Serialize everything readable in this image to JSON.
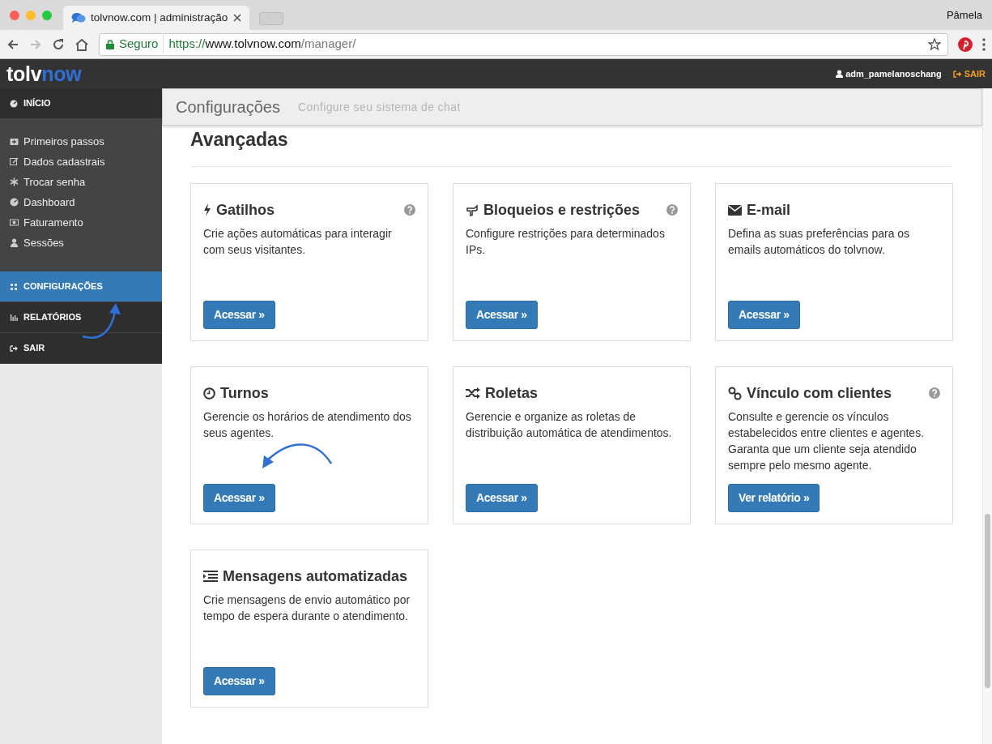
{
  "browser": {
    "tab_title": "tolvnow.com | administração",
    "profile": "Pâmela",
    "security_label": "Seguro",
    "url": {
      "scheme": "https://",
      "host": "www.tolvnow.com",
      "path": "/manager/"
    }
  },
  "header": {
    "logo": {
      "text": "tolv",
      "accent": "now"
    },
    "user": "adm_pamelanoschang",
    "logout": "SAIR"
  },
  "sidebar": {
    "items": [
      {
        "label": "INÍCIO",
        "kind": "main",
        "selected": false
      },
      {
        "label": "Primeiros passos",
        "kind": "sub",
        "selected": false
      },
      {
        "label": "Dados cadastrais",
        "kind": "sub",
        "selected": false
      },
      {
        "label": "Trocar senha",
        "kind": "sub",
        "selected": false
      },
      {
        "label": "Dashboard",
        "kind": "sub",
        "selected": false
      },
      {
        "label": "Faturamento",
        "kind": "sub",
        "selected": false
      },
      {
        "label": "Sessões",
        "kind": "sub",
        "selected": false
      },
      {
        "label": "CONFIGURAÇÕES",
        "kind": "main",
        "selected": true
      },
      {
        "label": "RELATÓRIOS",
        "kind": "main",
        "selected": false
      },
      {
        "label": "SAIR",
        "kind": "main",
        "selected": false
      }
    ]
  },
  "page_header": {
    "title": "Configurações",
    "subtitle": "Configure seu sistema de chat"
  },
  "section": {
    "title": "Avançadas",
    "cards": [
      {
        "title": "Gatilhos",
        "description": "Crie ações automáticas para interagir com seus visitantes.",
        "button": "Acessar »",
        "help": true
      },
      {
        "title": "Bloqueios e restrições",
        "description": "Configure restrições para determinados IPs.",
        "button": "Acessar »",
        "help": true
      },
      {
        "title": "E-mail",
        "description": "Defina as suas preferências para os emails automáticos do tolvnow.",
        "button": "Acessar »",
        "help": false
      },
      {
        "title": "Turnos",
        "description": "Gerencie os horários de atendimento dos seus agentes.",
        "button": "Acessar »",
        "help": false
      },
      {
        "title": "Roletas",
        "description": "Gerencie e organize as roletas de distribuição automática de atendimentos.",
        "button": "Acessar »",
        "help": false
      },
      {
        "title": "Vínculo com clientes",
        "description": "Consulte e gerencie os vínculos estabelecidos entre clientes e agentes. Garanta que um cliente seja atendido sempre pelo mesmo agente.",
        "button": "Ver relatório »",
        "help": true
      },
      {
        "title": "Mensagens automatizadas",
        "description": "Crie mensagens de envio automático por tempo de espera durante o atendimento.",
        "button": "Acessar »",
        "help": false
      }
    ]
  }
}
